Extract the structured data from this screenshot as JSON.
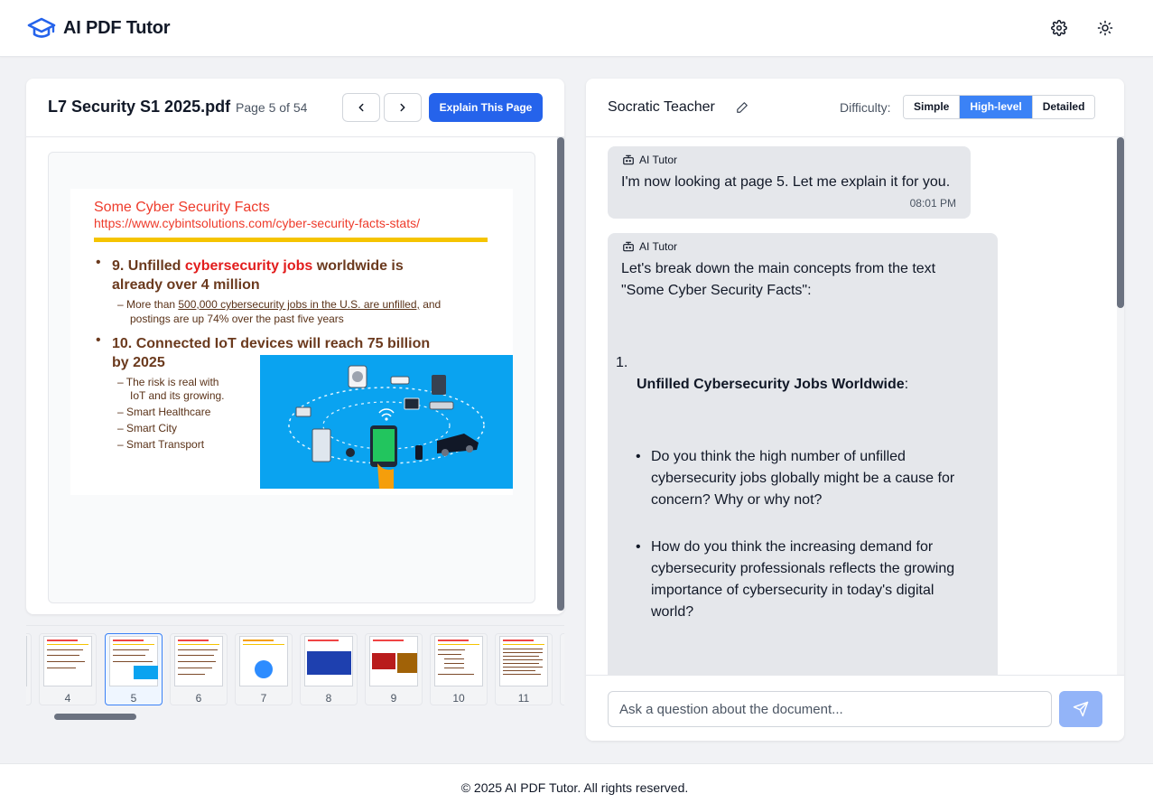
{
  "app": {
    "title": "AI PDF Tutor",
    "brand_color": "#2563eb",
    "icons": {
      "logo": "graduation-cap-icon",
      "settings": "gear-icon",
      "theme": "sun-icon"
    }
  },
  "document": {
    "filename": "L7 Security S1 2025.pdf",
    "page_indicator": "Page 5 of 54",
    "current_page": 5,
    "total_pages": 54,
    "explain_label": "Explain This Page",
    "slide": {
      "title": "Some Cyber Security Facts",
      "url": "https://www.cybintsolutions.com/cyber-security-facts-stats/",
      "b1_prefix": "9. Unfilled ",
      "b1_highlight": "cybersecurity jobs",
      "b1_suffix": " worldwide is",
      "b1_line2": "already over 4 million",
      "b1_sub_prefix": "– More than ",
      "b1_sub_link": "500,000 cybersecurity jobs in the U.S. are unfilled,",
      "b1_sub_suffix": " and",
      "b1_sub_line2": "postings are up 74% over the past five years",
      "b2_line1": "10. Connected IoT devices will reach 75 billion",
      "b2_line2": "by 2025",
      "sub_items": [
        "– The risk is real with",
        "IoT and its growing.",
        "– Smart Healthcare",
        "– Smart City",
        "– Smart Transport"
      ]
    },
    "thumbnails": [
      {
        "label": "4"
      },
      {
        "label": "5"
      },
      {
        "label": "6"
      },
      {
        "label": "7"
      },
      {
        "label": "8"
      },
      {
        "label": "9"
      },
      {
        "label": "10"
      },
      {
        "label": "11"
      }
    ]
  },
  "chat": {
    "persona": "Socratic Teacher",
    "difficulty_label": "Difficulty:",
    "difficulty_options": [
      "Simple",
      "High-level",
      "Detailed"
    ],
    "difficulty_selected": "High-level",
    "messages": [
      {
        "sender": "AI Tutor",
        "text": "I'm now looking at page 5. Let me explain it for you.",
        "time": "08:01 PM"
      },
      {
        "sender": "AI Tutor",
        "intro_line1": "Let's break down the main concepts from the text",
        "intro_line2": "\"Some Cyber Security Facts\":",
        "list_number": "1.",
        "heading": "Unfilled Cybersecurity Jobs Worldwide",
        "heading_colon": ":",
        "q1": [
          "Do you think the high number of unfilled",
          "cybersecurity jobs globally might be a cause for",
          "concern? Why or why not?"
        ],
        "q2": [
          "How do you think the increasing demand for",
          "cybersecurity professionals reflects the growing",
          "importance of cybersecurity in today's digital",
          "world?"
        ]
      }
    ],
    "input_placeholder": "Ask a question about the document...",
    "input_value": ""
  },
  "footer": {
    "text": "© 2025 AI PDF Tutor. All rights reserved."
  }
}
